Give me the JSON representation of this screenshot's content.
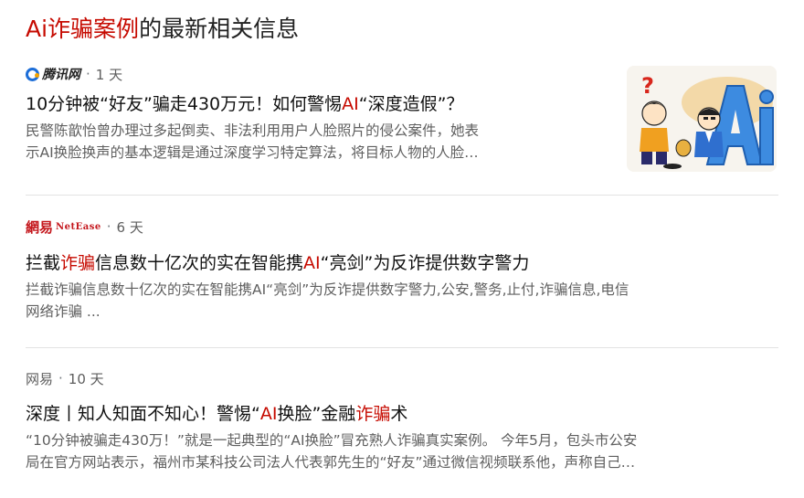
{
  "header": {
    "highlight": "Ai诈骗案例",
    "rest": "的最新相关信息"
  },
  "results": [
    {
      "source": "腾讯网",
      "time": "1 天",
      "title_parts": [
        "10分钟被“好友”骗走430万元！如何警惕",
        "AI",
        "“深度造假”？"
      ],
      "snippet_lines": [
        "民警陈歆怡曾办理过多起倒卖、非法利用用户人脸照片的侵公案件，她表",
        "示AI换脸换声的基本逻辑是通过深度学习特定算法，将目标人物的人脸…"
      ],
      "has_thumbnail": true
    },
    {
      "source": "網易",
      "source_en": "NetEase",
      "time": "6 天",
      "title_parts": [
        "拦截",
        "诈骗",
        "信息数十亿次的实在智能携",
        "AI",
        "“亮剑”为反诈提供数字警力"
      ],
      "snippet_lines": [
        "拦截诈骗信息数十亿次的实在智能携AI“亮剑”为反诈提供数字警力,公安,警务,止付,诈骗信息,电信",
        "网络诈骗 ..."
      ]
    },
    {
      "source": "网易",
      "time": "10 天",
      "title_parts": [
        "深度丨知人知面不知心！警惕“",
        "AI",
        "换脸”金融",
        "诈骗",
        "术"
      ],
      "snippet_lines": [
        "“10分钟被骗走430万！”就是一起典型的“AI换脸”冒充熟人诈骗真实案例。 今年5月，包头市公安",
        "局在官方网站表示，福州市某科技公司法人代表郭先生的“好友”通过微信视频联系他，声称自己…"
      ]
    }
  ],
  "separator": "·",
  "colors": {
    "highlight": "#c60a00",
    "title": "#111111",
    "snippet": "#5f5f5f",
    "meta": "#5e5e5e",
    "divider": "#e3e3e3",
    "tencent_blue": "#1d6ed8",
    "netease_red": "#c4161c"
  }
}
